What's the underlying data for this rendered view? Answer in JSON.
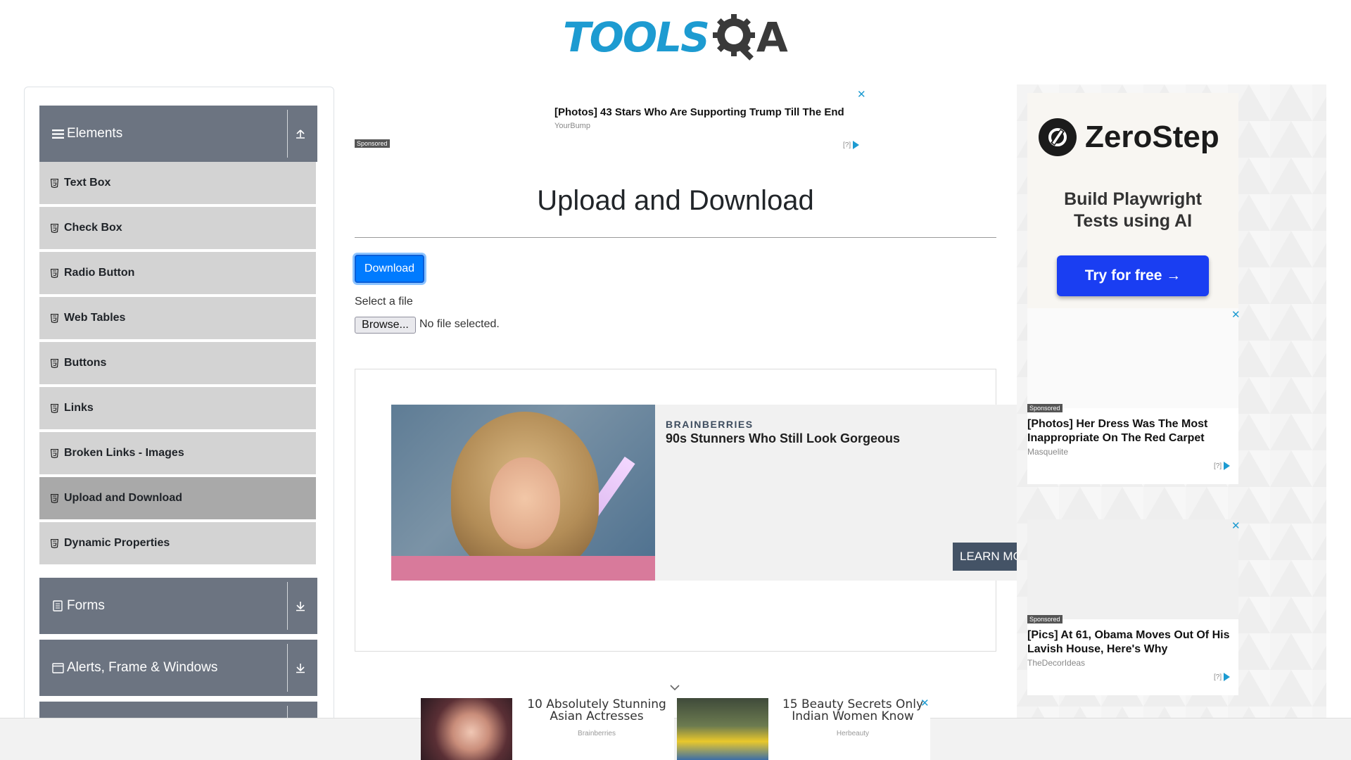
{
  "logo": {
    "tools": "TOOLS",
    "qa": "A"
  },
  "sidebar": {
    "groups": [
      {
        "label": "Elements",
        "icon": "hamburger-icon",
        "arrow": "collapse-icon"
      },
      {
        "label": "Forms",
        "icon": "form-icon",
        "arrow": "expand-icon"
      },
      {
        "label": "Alerts, Frame & Windows",
        "icon": "window-icon",
        "arrow": "expand-icon"
      }
    ],
    "items": [
      {
        "label": "Text Box"
      },
      {
        "label": "Check Box"
      },
      {
        "label": "Radio Button"
      },
      {
        "label": "Web Tables"
      },
      {
        "label": "Buttons"
      },
      {
        "label": "Links"
      },
      {
        "label": "Broken Links - Images"
      },
      {
        "label": "Upload and Download",
        "active": true
      },
      {
        "label": "Dynamic Properties"
      }
    ]
  },
  "top_ad": {
    "title": "[Photos] 43 Stars Who Are Supporting Trump Till The End",
    "source": "YourBump",
    "sponsored": "Sponsored",
    "adchoice": "[?]"
  },
  "main": {
    "title": "Upload and Download",
    "download_label": "Download",
    "select_label": "Select a file",
    "browse_label": "Browse...",
    "file_status": "No file selected."
  },
  "content_ad": {
    "brand": "BRAINBERRIES",
    "headline": "90s Stunners Who Still Look Gorgeous",
    "cta": "LEARN MORE"
  },
  "right_ads": {
    "zerostep": {
      "name": "ZeroStep",
      "tagline_1": "Build Playwright",
      "tagline_2": "Tests using AI",
      "cta": "Try for free →"
    },
    "cards": [
      {
        "sponsored": "Sponsored",
        "title": "[Photos] Her Dress Was The Most Inappropriate On The Red Carpet",
        "source": "Masquelite",
        "adchoice": "[?]"
      },
      {
        "sponsored": "Sponsored",
        "title": "[Pics] At 61, Obama Moves Out Of His Lavish House, Here's Why",
        "source": "TheDecorIdeas",
        "adchoice": "[?]"
      }
    ]
  },
  "bottom_ads": [
    {
      "title": "10 Absolutely Stunning Asian Actresses",
      "source": "Brainberries"
    },
    {
      "title": "15 Beauty Secrets Only Indian Women Know",
      "source": "Herbeauty"
    }
  ],
  "colors": {
    "brand_blue": "#1d9bd1",
    "sidebar_header": "#6c7481",
    "menu_item": "#d3d3d3",
    "menu_item_active": "#a9a9a9",
    "primary_button": "#007bff"
  }
}
